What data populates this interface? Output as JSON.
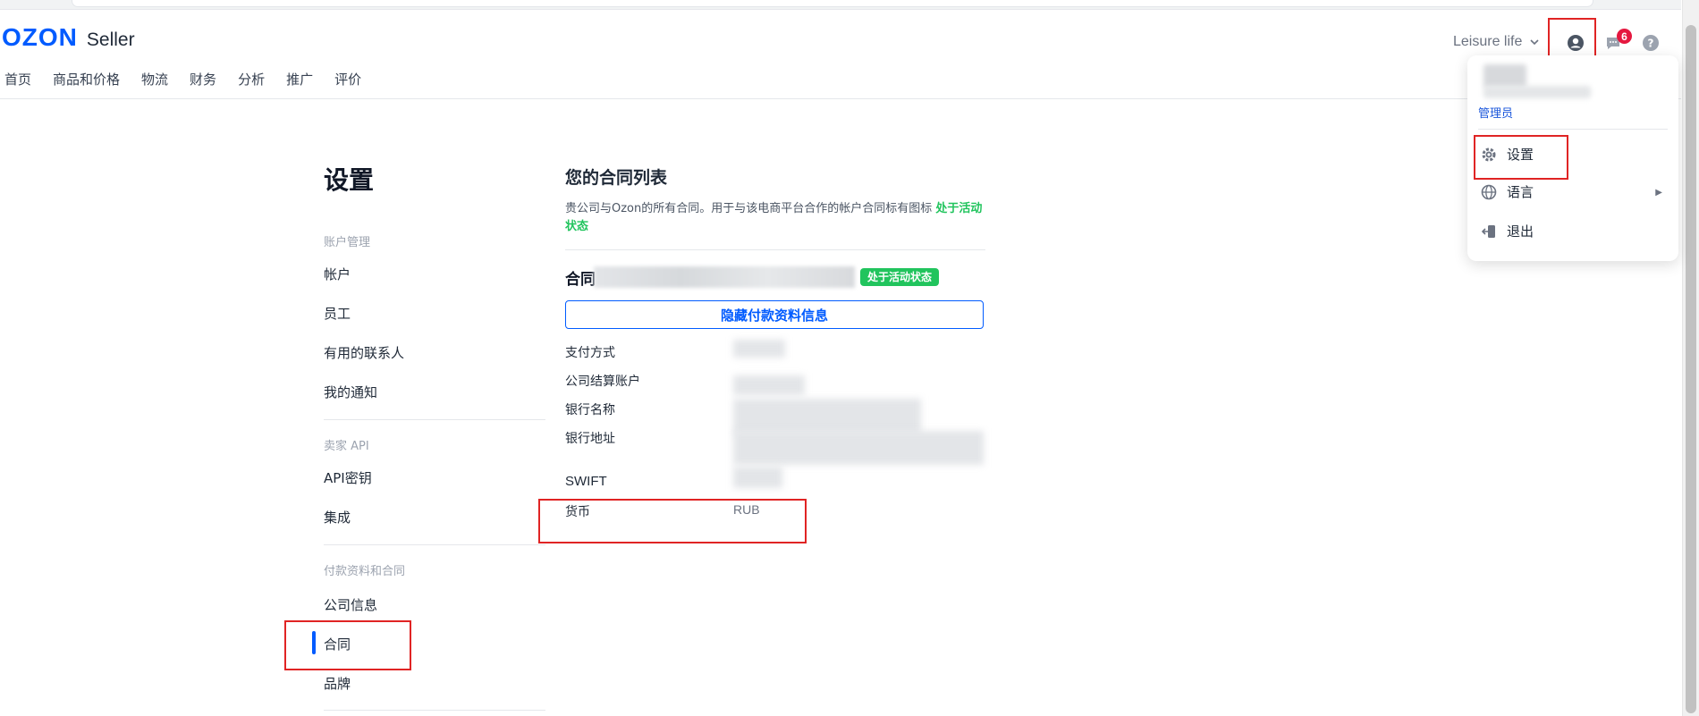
{
  "header": {
    "logo_brand": "OZON",
    "logo_suffix": "Seller",
    "nav": [
      "首页",
      "商品和价格",
      "物流",
      "财务",
      "分析",
      "推广",
      "评价"
    ],
    "store_name": "Leisure life",
    "notification_count": "6"
  },
  "user_menu": {
    "role": "管理员",
    "items": [
      {
        "label": "设置",
        "icon": "gear-icon"
      },
      {
        "label": "语言",
        "icon": "globe-icon"
      },
      {
        "label": "退出",
        "icon": "logout-icon"
      }
    ]
  },
  "sidebar": {
    "title": "设置",
    "sections": [
      {
        "heading": "账户管理",
        "items": [
          "帐户",
          "员工",
          "有用的联系人",
          "我的通知"
        ]
      },
      {
        "heading": "卖家 API",
        "items": [
          "API密钥",
          "集成"
        ]
      },
      {
        "heading": "付款资料和合同",
        "items": [
          "公司信息",
          "合同",
          "品牌"
        ]
      }
    ],
    "active_item": "合同"
  },
  "main": {
    "title": "您的合同列表",
    "desc_text": "贵公司与Ozon的所有合同。用于与该电商平台合作的帐户合同标有图标",
    "desc_highlight": "处于活动状态",
    "contract_label": "合同",
    "active_badge": "处于活动状态",
    "hide_button": "隐藏付款资料信息",
    "fields": {
      "payment_method": "支付方式",
      "settlement_account": "公司结算账户",
      "bank_name": "银行名称",
      "bank_address": "银行地址",
      "swift": "SWIFT",
      "currency_label": "货币",
      "currency_value": "RUB"
    }
  },
  "colors": {
    "brand": "#005bff",
    "active_green": "#21c45d",
    "highlight_red": "#e02424",
    "badge_red": "#e5173f"
  }
}
